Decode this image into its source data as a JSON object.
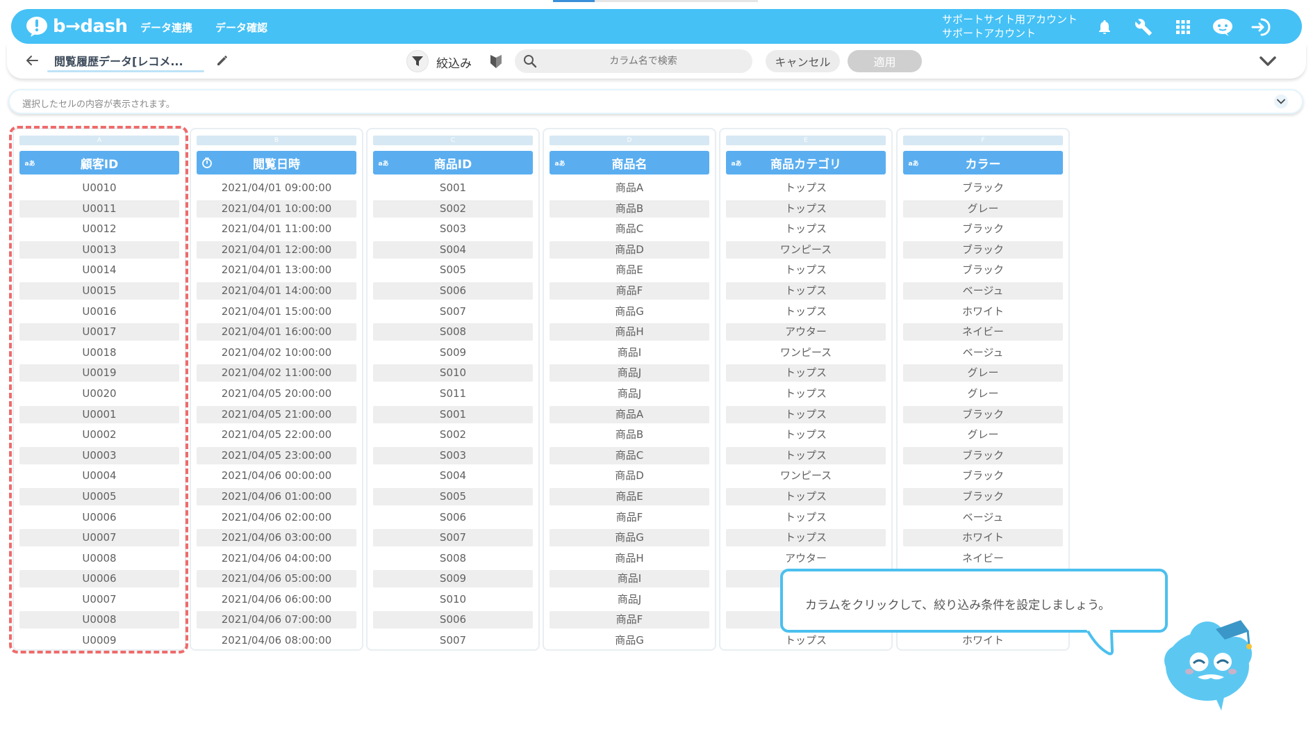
{
  "header": {
    "logo_text": "b→dash",
    "nav": [
      "データ連携",
      "データ確認"
    ],
    "account_line1": "サポートサイト用アカウント",
    "account_line2": "サポートアカウント",
    "icons": [
      "bell-icon",
      "wrench-icon",
      "grid-icon",
      "chat-mascot-icon",
      "logout-icon"
    ]
  },
  "toolbar": {
    "dataset_name": "閲覧履歴データ[レコメ...",
    "filter_label": "絞込み",
    "search_placeholder": "カラム名で検索",
    "cancel_label": "キャンセル",
    "apply_label": "適用"
  },
  "cell_display": {
    "placeholder": "選択したセルの内容が表示されます。"
  },
  "columns": [
    {
      "letter": "A",
      "type_icon": "a-text",
      "name": "顧客ID",
      "values": [
        "U0010",
        "U0011",
        "U0012",
        "U0013",
        "U0014",
        "U0015",
        "U0016",
        "U0017",
        "U0018",
        "U0019",
        "U0020",
        "U0001",
        "U0002",
        "U0003",
        "U0004",
        "U0005",
        "U0006",
        "U0007",
        "U0008",
        "U0006",
        "U0007",
        "U0008",
        "U0009"
      ]
    },
    {
      "letter": "B",
      "type_icon": "clock",
      "name": "閲覧日時",
      "values": [
        "2021/04/01 09:00:00",
        "2021/04/01 10:00:00",
        "2021/04/01 11:00:00",
        "2021/04/01 12:00:00",
        "2021/04/01 13:00:00",
        "2021/04/01 14:00:00",
        "2021/04/01 15:00:00",
        "2021/04/01 16:00:00",
        "2021/04/02 10:00:00",
        "2021/04/02 11:00:00",
        "2021/04/05 20:00:00",
        "2021/04/05 21:00:00",
        "2021/04/05 22:00:00",
        "2021/04/05 23:00:00",
        "2021/04/06 00:00:00",
        "2021/04/06 01:00:00",
        "2021/04/06 02:00:00",
        "2021/04/06 03:00:00",
        "2021/04/06 04:00:00",
        "2021/04/06 05:00:00",
        "2021/04/06 06:00:00",
        "2021/04/06 07:00:00",
        "2021/04/06 08:00:00"
      ]
    },
    {
      "letter": "C",
      "type_icon": "a-text",
      "name": "商品ID",
      "values": [
        "S001",
        "S002",
        "S003",
        "S004",
        "S005",
        "S006",
        "S007",
        "S008",
        "S009",
        "S010",
        "S011",
        "S001",
        "S002",
        "S003",
        "S004",
        "S005",
        "S006",
        "S007",
        "S008",
        "S009",
        "S010",
        "S006",
        "S007"
      ]
    },
    {
      "letter": "D",
      "type_icon": "a-text",
      "name": "商品名",
      "values": [
        "商品A",
        "商品B",
        "商品C",
        "商品D",
        "商品E",
        "商品F",
        "商品G",
        "商品H",
        "商品I",
        "商品J",
        "商品J",
        "商品A",
        "商品B",
        "商品C",
        "商品D",
        "商品E",
        "商品F",
        "商品G",
        "商品H",
        "商品I",
        "商品J",
        "商品F",
        "商品G"
      ]
    },
    {
      "letter": "E",
      "type_icon": "a-text",
      "name": "商品カテゴリ",
      "values": [
        "トップス",
        "トップス",
        "トップス",
        "ワンピース",
        "トップス",
        "トップス",
        "トップス",
        "アウター",
        "ワンピース",
        "トップス",
        "トップス",
        "トップス",
        "トップス",
        "トップス",
        "ワンピース",
        "トップス",
        "トップス",
        "トップス",
        "アウター",
        "",
        "",
        "",
        "トップス"
      ]
    },
    {
      "letter": "F",
      "type_icon": "a-text",
      "name": "カラー",
      "values": [
        "ブラック",
        "グレー",
        "ブラック",
        "ブラック",
        "ブラック",
        "ベージュ",
        "ホワイト",
        "ネイビー",
        "ベージュ",
        "グレー",
        "グレー",
        "ブラック",
        "グレー",
        "ブラック",
        "ブラック",
        "ブラック",
        "ベージュ",
        "ホワイト",
        "ネイビー",
        "",
        "",
        "",
        "ホワイト"
      ]
    }
  ],
  "tooltip": {
    "text": "カラムをクリックして、絞り込み条件を設定しましょう。"
  }
}
